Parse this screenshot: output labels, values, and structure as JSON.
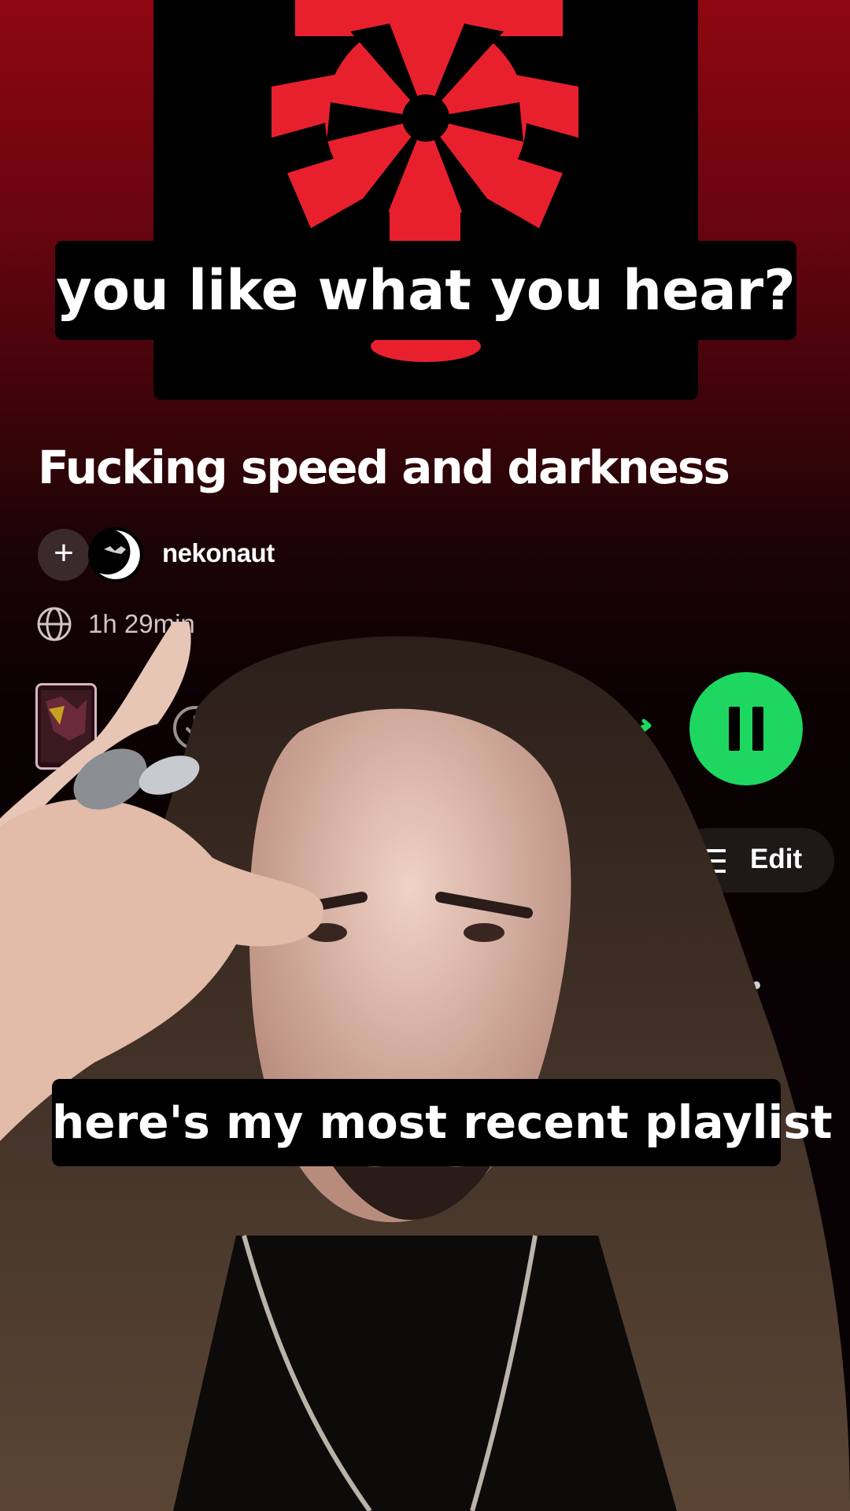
{
  "captions": {
    "top": "you like what you hear?",
    "bottom": "here's my most recent playlist"
  },
  "playlist": {
    "title": "Fucking speed and darkness",
    "owner": "nekonaut",
    "duration": "1h 29min",
    "edit_label": "Edit"
  },
  "icons": {
    "add": "plus-icon",
    "visibility": "globe-icon",
    "download": "download-icon",
    "smart_shuffle": "smart-shuffle-icon",
    "pause": "pause-icon",
    "sort": "list-icon",
    "more": "more-vertical-icon"
  },
  "colors": {
    "accent_green": "#1ed760",
    "cover_red": "#e8202e",
    "header_red": "#8e0710"
  }
}
